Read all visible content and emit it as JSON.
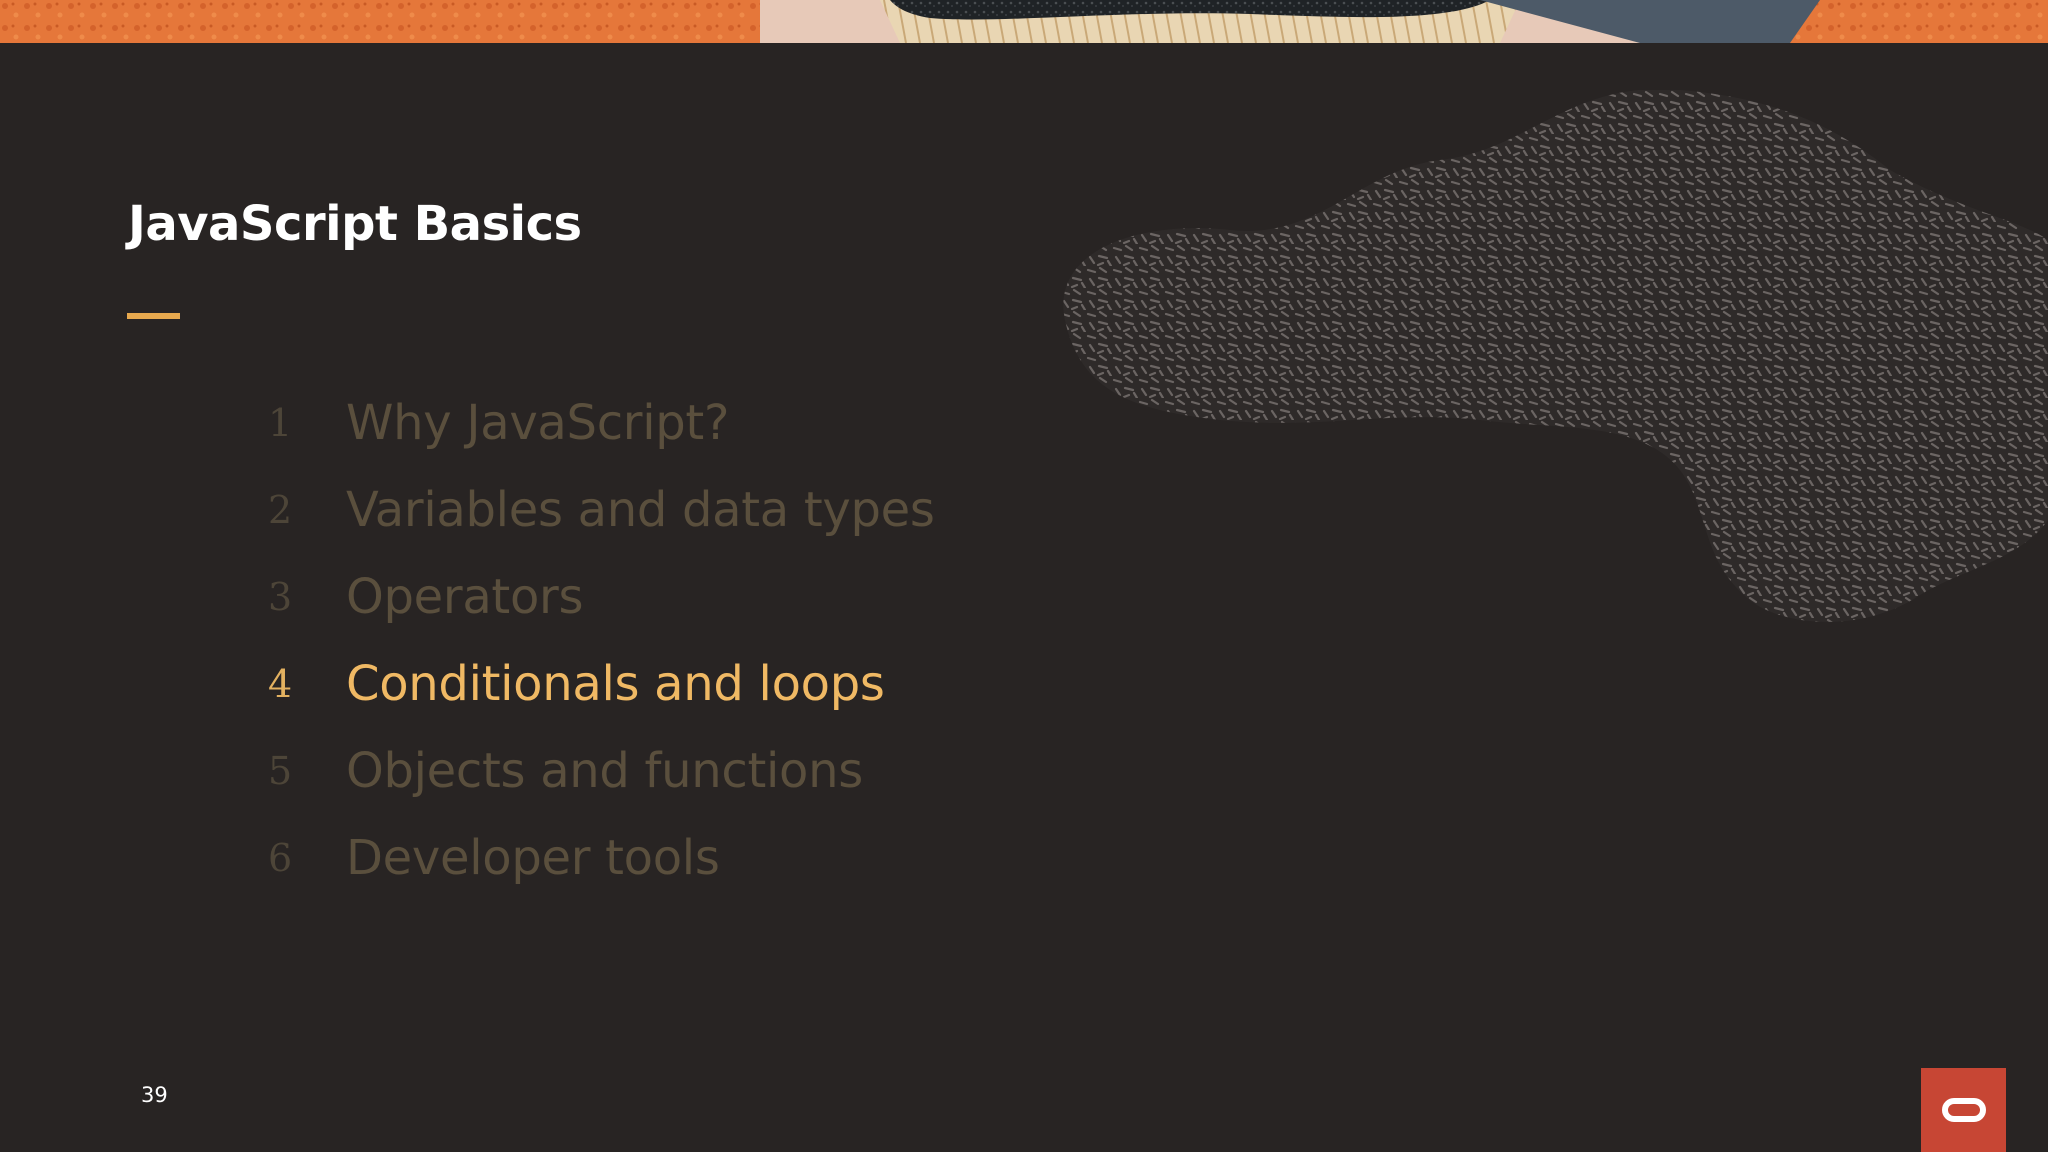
{
  "slide": {
    "title": "JavaScript Basics",
    "page_number": "39"
  },
  "agenda": {
    "items": [
      {
        "number": "1",
        "label": "Why JavaScript?",
        "active": false
      },
      {
        "number": "2",
        "label": "Variables and data types",
        "active": false
      },
      {
        "number": "3",
        "label": "Operators",
        "active": false
      },
      {
        "number": "4",
        "label": "Conditionals and loops",
        "active": true
      },
      {
        "number": "5",
        "label": "Objects and functions",
        "active": false
      },
      {
        "number": "6",
        "label": "Developer tools",
        "active": false
      }
    ]
  },
  "colors": {
    "background": "#282423",
    "accent": "#e8a94e",
    "active_item": "#f0b964",
    "inactive_item": "#5a4f3d",
    "brand_red": "#c74634",
    "title": "#ffffff"
  },
  "icons": {
    "logo": "oracle-logo-icon"
  }
}
